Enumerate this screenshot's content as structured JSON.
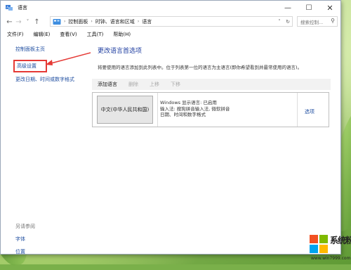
{
  "window": {
    "title": "语言"
  },
  "titlebar": {
    "minimize": "—",
    "maximize": "☐",
    "close": "✕"
  },
  "address": {
    "back": "←",
    "forward": "→",
    "down": "˅",
    "up": "↑",
    "crumbs": [
      "控制面板",
      "时钟、语言和区域",
      "语言"
    ],
    "sep": "›",
    "dropdown": "˅",
    "refresh": "↻",
    "search_placeholder": "搜索控制...",
    "search_icon": "⚲"
  },
  "menu": [
    "文件(F)",
    "编辑(E)",
    "查看(V)",
    "工具(T)",
    "帮助(H)"
  ],
  "left": {
    "links": [
      "控制面板主页",
      "高级设置",
      "更改日期、时间或数字格式"
    ],
    "see_also": "另请参阅",
    "bottom_links": [
      "字体",
      "位置"
    ]
  },
  "main": {
    "heading": "更改语言首选项",
    "description": "将要使用的语言添加到此列表中。位于列表第一位的语言为主语言(即你希望看到并最常使用的语言)。",
    "tools": [
      "添加语言",
      "删除",
      "上移",
      "下移"
    ],
    "language": {
      "name": "中文(中华人民共和国)",
      "info": [
        "Windows 显示语言: 已启用",
        "输入法: 搜狗拼音输入法, 微软拼音",
        "日期、时间和数字格式"
      ],
      "options": "选项"
    }
  },
  "watermark": {
    "text": "系统粉",
    "url": "www.win7999.com",
    "colors": [
      "#f25022",
      "#7fba00",
      "#00a4ef",
      "#ffb900"
    ]
  },
  "colors": {
    "link": "#1f4ea0",
    "highlight": "#e53935"
  }
}
